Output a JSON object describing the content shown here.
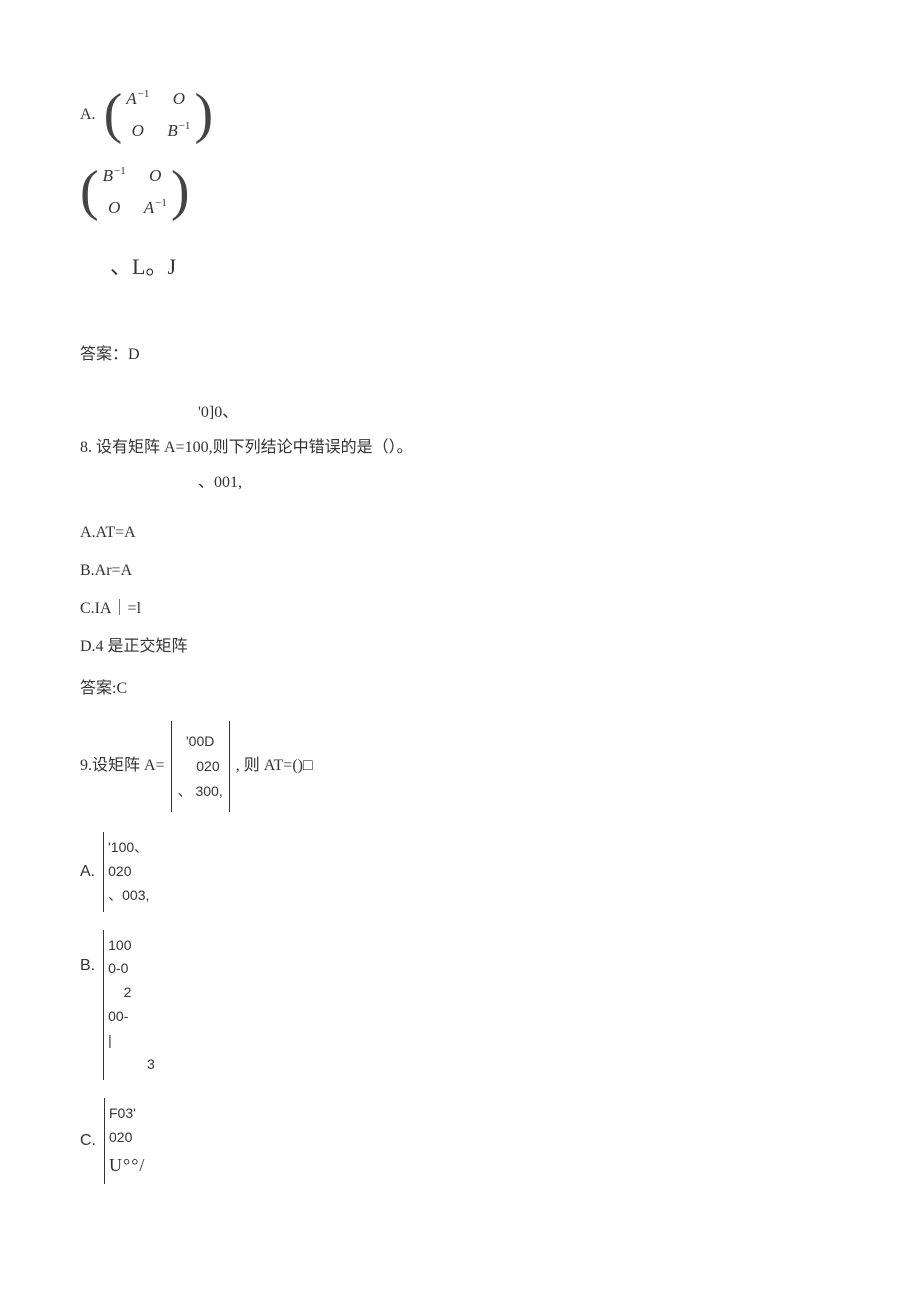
{
  "optionA": {
    "label": "A.",
    "m": [
      "A",
      "−1",
      "O",
      "O",
      "B",
      "−1"
    ]
  },
  "optionA2": {
    "m": [
      "B",
      "−1",
      "O",
      "O",
      "A",
      "−1"
    ]
  },
  "ljLine": "、L。J",
  "answer7": "答案：D",
  "q8": {
    "top": "'0]0、",
    "main": "8. 设有矩阵 A=100,则下列结论中错误的是（）。",
    "bottom": "、001,",
    "optA": "A.AT=A",
    "optB": "B.Ar=A",
    "optC": "C.IA｜=l",
    "optD": "D.4 是正交矩阵",
    "answer": "答案:C"
  },
  "q9": {
    "prefix": "9.设矩阵 A=",
    "matrix": [
      "'00D",
      "    020",
      "、 300,"
    ],
    "suffix": ", 则 AT=()□",
    "optA": {
      "label": "A.",
      "rows": [
        "'100、",
        "020",
        "、003,"
      ]
    },
    "optB": {
      "label": "B.",
      "rows": [
        "100",
        "0-0",
        "    2",
        "00-",
        "|",
        "          3"
      ]
    },
    "optC": {
      "label": "C.",
      "rows": [
        "F03'",
        "020",
        "U°°/"
      ]
    }
  }
}
